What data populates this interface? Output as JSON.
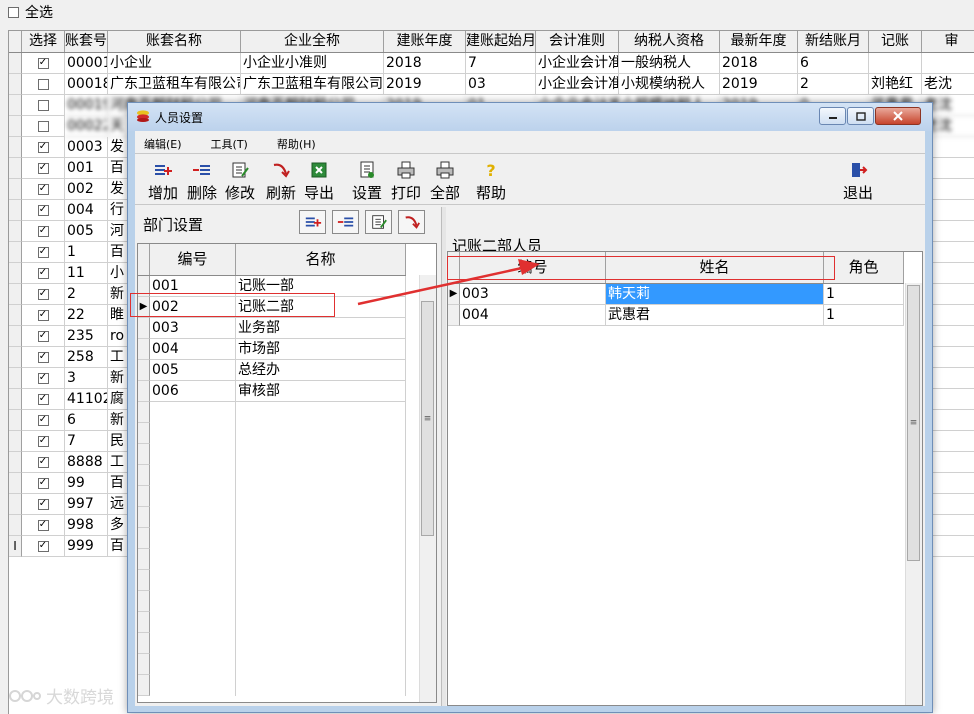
{
  "select_all": {
    "label": "全选",
    "checked": false
  },
  "grid": {
    "headers": [
      "选择",
      "账套号",
      "账套名称",
      "企业全称",
      "建账年度",
      "建账起始月",
      "会计准则",
      "纳税人资格",
      "最新年度",
      "新结账月",
      "记账",
      "审"
    ],
    "rows": [
      {
        "checked": true,
        "no": "00001",
        "name": "小企业",
        "full": "小企业小准则",
        "year": "2018",
        "start": "7",
        "std": "小企业会计准则",
        "tax": "一般纳税人",
        "latest": "2018",
        "month": "6",
        "clerk": "",
        "aud": ""
      },
      {
        "checked": false,
        "no": "00018",
        "name": "广东卫蓝租车有限公司",
        "full": "广东卫蓝租车有限公司",
        "year": "2019",
        "start": "03",
        "std": "小企业会计准则",
        "tax": "小规模纳税人",
        "latest": "2019",
        "month": "2",
        "clerk": "刘艳红",
        "aud": "老沈"
      },
      {
        "checked": false,
        "no": "00019",
        "name": "河南百朝财税公司",
        "full": "河南百朝财税公司",
        "year": "2019",
        "start": "01",
        "std": "小企业会计准则",
        "tax": "小规模纳税人",
        "latest": "2019",
        "month": "0",
        "clerk": "武惠君",
        "aud": "老沈"
      },
      {
        "checked": false,
        "no": "00022",
        "name": "天",
        "full": "",
        "year": "",
        "start": "",
        "std": "",
        "tax": "",
        "latest": "",
        "month": "",
        "clerk": "",
        "aud": "老沈"
      },
      {
        "checked": true,
        "no": "0003",
        "name": "发"
      },
      {
        "checked": true,
        "no": "001",
        "name": "百"
      },
      {
        "checked": true,
        "no": "002",
        "name": "发"
      },
      {
        "checked": true,
        "no": "004",
        "name": "行"
      },
      {
        "checked": true,
        "no": "005",
        "name": "河"
      },
      {
        "checked": true,
        "no": "1",
        "name": "百"
      },
      {
        "checked": true,
        "no": "11",
        "name": "小"
      },
      {
        "checked": true,
        "no": "2",
        "name": "新"
      },
      {
        "checked": true,
        "no": "22",
        "name": "睢"
      },
      {
        "checked": true,
        "no": "235",
        "name": "ro"
      },
      {
        "checked": true,
        "no": "258",
        "name": "工"
      },
      {
        "checked": true,
        "no": "3",
        "name": "新"
      },
      {
        "checked": true,
        "no": "41102",
        "name": "腐"
      },
      {
        "checked": true,
        "no": "6",
        "name": "新"
      },
      {
        "checked": true,
        "no": "7",
        "name": "民"
      },
      {
        "checked": true,
        "no": "8888",
        "name": "工"
      },
      {
        "checked": true,
        "no": "99",
        "name": "百"
      },
      {
        "checked": true,
        "no": "997",
        "name": "远"
      },
      {
        "checked": true,
        "no": "998",
        "name": "多"
      },
      {
        "checked": true,
        "no": "999",
        "name": "百",
        "marker": "I"
      }
    ]
  },
  "dialog": {
    "title": "人员设置",
    "menu": [
      "编辑(E)",
      "工具(T)",
      "帮助(H)"
    ],
    "toolbar": {
      "add": "增加",
      "delete": "删除",
      "edit": "修改",
      "refresh": "刷新",
      "export": "导出",
      "settings": "设置",
      "print": "打印",
      "all": "全部",
      "help": "帮助",
      "exit": "退出"
    },
    "dept": {
      "label": "部门设置",
      "headers": [
        "编号",
        "名称"
      ],
      "rows": [
        {
          "no": "001",
          "name": "记账一部"
        },
        {
          "no": "002",
          "name": "记账二部"
        },
        {
          "no": "003",
          "name": "业务部"
        },
        {
          "no": "004",
          "name": "市场部"
        },
        {
          "no": "005",
          "name": "总经办"
        },
        {
          "no": "006",
          "name": "审核部"
        }
      ],
      "selected_index": 1
    },
    "staff": {
      "label": "记账二部人员",
      "headers": [
        "编号",
        "姓名",
        "角色"
      ],
      "rows": [
        {
          "no": "003",
          "name": "韩天莉",
          "role": "1"
        },
        {
          "no": "004",
          "name": "武惠君",
          "role": "1"
        }
      ],
      "selected_index": 0
    }
  },
  "watermark": "大数跨境",
  "colors": {
    "selection": "#3399ff",
    "annotation": "#e03030",
    "title_bar": "#bcd2ec"
  }
}
